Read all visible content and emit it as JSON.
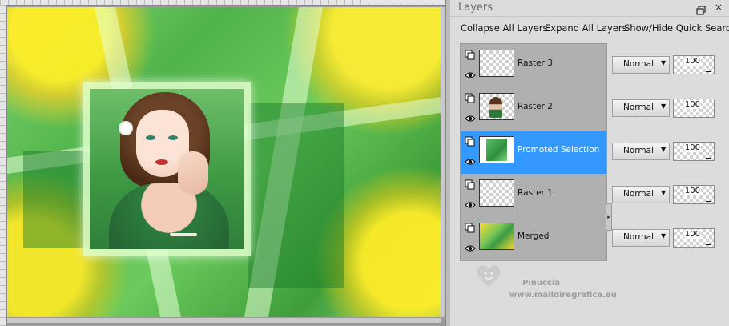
{
  "panel": {
    "title": "Layers",
    "restore_icon": "restore-window-icon",
    "close_icon": "close-icon"
  },
  "toolbar": {
    "collapse_label": "Collapse All Layers",
    "expand_label": "Expand All Layers",
    "quicksearch_label": "Show/Hide Quick Search"
  },
  "layers": [
    {
      "name": "Raster 3",
      "blend": "Normal",
      "opacity": "100",
      "selected": false,
      "thumb": "empty"
    },
    {
      "name": "Raster 2",
      "blend": "Normal",
      "opacity": "100",
      "selected": false,
      "thumb": "portrait"
    },
    {
      "name": "Promoted Selection",
      "blend": "Normal",
      "opacity": "100",
      "selected": true,
      "thumb": "green"
    },
    {
      "name": "Raster 1",
      "blend": "Normal",
      "opacity": "100",
      "selected": false,
      "thumb": "empty"
    },
    {
      "name": "Merged",
      "blend": "Normal",
      "opacity": "100",
      "selected": false,
      "thumb": "merged"
    }
  ],
  "watermark": {
    "name": "Pinuccia",
    "url": "www.maildiregrafica.eu"
  },
  "colors": {
    "selection": "#3399ff",
    "panel_bg": "#dcdcdc",
    "list_bg": "#b0b0b0"
  }
}
